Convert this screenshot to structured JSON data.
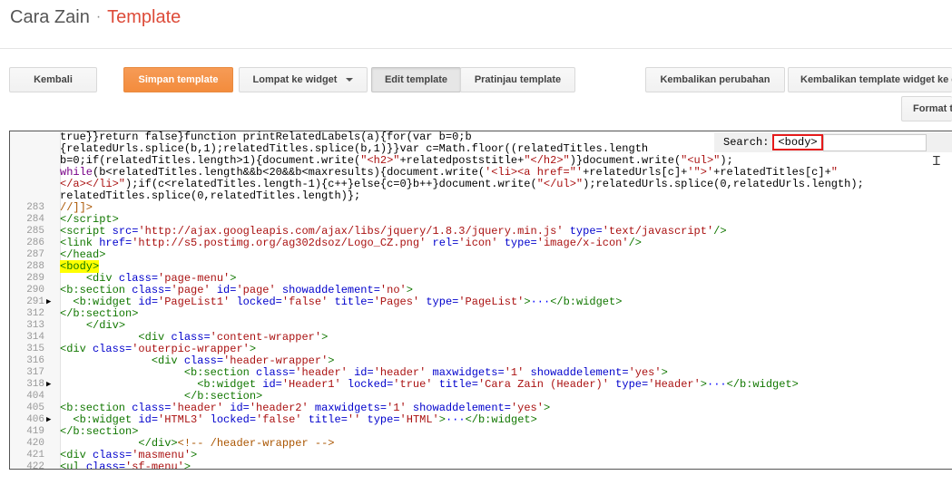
{
  "header": {
    "blog_name": "Cara Zain",
    "separator": "·",
    "page_name": "Template"
  },
  "toolbar": {
    "back": "Kembali",
    "save": "Simpan template",
    "jump": "Lompat ke widget",
    "edit": "Edit template",
    "preview": "Pratinjau template",
    "revert_changes": "Kembalikan perubahan",
    "revert_widgets": "Kembalikan template widget ke default",
    "format": "Format template"
  },
  "search": {
    "label": "Search:",
    "query": "<body>"
  },
  "editor": {
    "lines": [
      {
        "n": "",
        "m": "",
        "html": "true}}return false}function printRelatedLabels(a){for(var b=0;b<relatedUrls.length;b++){if"
      },
      {
        "n": "",
        "m": "",
        "html": "{relatedUrls.splice(b,1);relatedTitles.splice(b,1)}}var c=Math.floor((relatedTitles.length"
      },
      {
        "n": "",
        "m": "",
        "html": "b=0;if(relatedTitles.length>1){document.write(<span class=\"t-str\">\"&lt;h2&gt;\"</span>+relatedpoststitle+<span class=\"t-str\">\"&lt;/h2&gt;\"</span>)}document.write(<span class=\"t-str\">\"&lt;ul&gt;\"</span>);"
      },
      {
        "n": "",
        "m": "",
        "html": "<span class=\"t-kw\">while</span>(b&lt;relatedTitles.length&amp;&amp;b&lt;20&amp;&amp;b&lt;maxresults){document.write(<span class=\"t-str\">'&lt;li&gt;&lt;a href=\"'</span>+relatedUrls[c]+<span class=\"t-str\">'\"&gt;'</span>+relatedTitles[c]+<span class=\"t-str\">\"</span>"
      },
      {
        "n": "",
        "m": "",
        "html": "<span class=\"t-str\">&lt;/a&gt;&lt;/li&gt;\"</span>);if(c&lt;relatedTitles.length-1){c++}else{c=0}b++}document.write(<span class=\"t-str\">\"&lt;/ul&gt;\"</span>);relatedUrls.splice(0,relatedUrls.length);"
      },
      {
        "n": "",
        "m": "",
        "html": "relatedTitles.splice(0,relatedTitles.length)};"
      },
      {
        "n": "283",
        "m": "",
        "html": "<span class=\"t-cmt\">//]]&gt;</span>"
      },
      {
        "n": "284",
        "m": "",
        "html": "<span class=\"t-tag\">&lt;/script&gt;</span>"
      },
      {
        "n": "285",
        "m": "",
        "html": "<span class=\"t-tag\">&lt;script</span> <span class=\"t-attr\">src=</span><span class=\"t-str\">'http://ajax.googleapis.com/ajax/libs/jquery/1.8.3/jquery.min.js'</span> <span class=\"t-attr\">type=</span><span class=\"t-str\">'text/javascript'</span><span class=\"t-tag\">/&gt;</span>"
      },
      {
        "n": "286",
        "m": "",
        "html": "<span class=\"t-tag\">&lt;link</span> <span class=\"t-attr\">href=</span><span class=\"t-str\">'http://s5.postimg.org/ag302dsoz/Logo_CZ.png'</span> <span class=\"t-attr\">rel=</span><span class=\"t-str\">'icon'</span> <span class=\"t-attr\">type=</span><span class=\"t-str\">'image/x-icon'</span><span class=\"t-tag\">/&gt;</span>"
      },
      {
        "n": "287",
        "m": "",
        "html": "<span class=\"t-tag\">&lt;/head&gt;</span>"
      },
      {
        "n": "288",
        "m": "",
        "html": "<span class=\"t-tag hl\">&lt;body&gt;</span>"
      },
      {
        "n": "289",
        "m": "",
        "html": "    <span class=\"t-tag\">&lt;div</span> <span class=\"t-attr\">class=</span><span class=\"t-str\">'page-menu'</span><span class=\"t-tag\">&gt;</span>"
      },
      {
        "n": "290",
        "m": "",
        "html": "<span class=\"t-tag\">&lt;b:section</span> <span class=\"t-attr\">class=</span><span class=\"t-str\">'page'</span> <span class=\"t-attr\">id=</span><span class=\"t-str\">'page'</span> <span class=\"t-attr\">showaddelement=</span><span class=\"t-str\">'no'</span><span class=\"t-tag\">&gt;</span>"
      },
      {
        "n": "291",
        "m": "▶",
        "html": "  <span class=\"t-tag\">&lt;b:widget</span> <span class=\"t-attr\">id=</span><span class=\"t-str\">'PageList1'</span> <span class=\"t-attr\">locked=</span><span class=\"t-str\">'false'</span> <span class=\"t-attr\">title=</span><span class=\"t-str\">'Pages'</span> <span class=\"t-attr\">type=</span><span class=\"t-str\">'PageList'</span><span class=\"t-tag\">&gt;</span><span class=\"t-fold\">···</span><span class=\"t-tag\">&lt;/b:widget&gt;</span>"
      },
      {
        "n": "312",
        "m": "",
        "html": "<span class=\"t-tag\">&lt;/b:section&gt;</span>"
      },
      {
        "n": "313",
        "m": "",
        "html": "    <span class=\"t-tag\">&lt;/div&gt;</span>"
      },
      {
        "n": "314",
        "m": "",
        "html": "            <span class=\"t-tag\">&lt;div</span> <span class=\"t-attr\">class=</span><span class=\"t-str\">'content-wrapper'</span><span class=\"t-tag\">&gt;</span>"
      },
      {
        "n": "315",
        "m": "",
        "html": "<span class=\"t-tag\">&lt;div</span> <span class=\"t-attr\">class=</span><span class=\"t-str\">'outerpic-wrapper'</span><span class=\"t-tag\">&gt;</span>"
      },
      {
        "n": "316",
        "m": "",
        "html": "              <span class=\"t-tag\">&lt;div</span> <span class=\"t-attr\">class=</span><span class=\"t-str\">'header-wrapper'</span><span class=\"t-tag\">&gt;</span>"
      },
      {
        "n": "317",
        "m": "",
        "html": "                   <span class=\"t-tag\">&lt;b:section</span> <span class=\"t-attr\">class=</span><span class=\"t-str\">'header'</span> <span class=\"t-attr\">id=</span><span class=\"t-str\">'header'</span> <span class=\"t-attr\">maxwidgets=</span><span class=\"t-str\">'1'</span> <span class=\"t-attr\">showaddelement=</span><span class=\"t-str\">'yes'</span><span class=\"t-tag\">&gt;</span>"
      },
      {
        "n": "318",
        "m": "▶",
        "html": "                     <span class=\"t-tag\">&lt;b:widget</span> <span class=\"t-attr\">id=</span><span class=\"t-str\">'Header1'</span> <span class=\"t-attr\">locked=</span><span class=\"t-str\">'true'</span> <span class=\"t-attr\">title=</span><span class=\"t-str\">'Cara Zain (Header)'</span> <span class=\"t-attr\">type=</span><span class=\"t-str\">'Header'</span><span class=\"t-tag\">&gt;</span><span class=\"t-fold\">···</span><span class=\"t-tag\">&lt;/b:widget&gt;</span>"
      },
      {
        "n": "404",
        "m": "",
        "html": "                   <span class=\"t-tag\">&lt;/b:section&gt;</span>"
      },
      {
        "n": "405",
        "m": "",
        "html": "<span class=\"t-tag\">&lt;b:section</span> <span class=\"t-attr\">class=</span><span class=\"t-str\">'header'</span> <span class=\"t-attr\">id=</span><span class=\"t-str\">'header2'</span> <span class=\"t-attr\">maxwidgets=</span><span class=\"t-str\">'1'</span> <span class=\"t-attr\">showaddelement=</span><span class=\"t-str\">'yes'</span><span class=\"t-tag\">&gt;</span>"
      },
      {
        "n": "406",
        "m": "▶",
        "html": "  <span class=\"t-tag\">&lt;b:widget</span> <span class=\"t-attr\">id=</span><span class=\"t-str\">'HTML3'</span> <span class=\"t-attr\">locked=</span><span class=\"t-str\">'false'</span> <span class=\"t-attr\">title=</span><span class=\"t-str\">''</span> <span class=\"t-attr\">type=</span><span class=\"t-str\">'HTML'</span><span class=\"t-tag\">&gt;</span><span class=\"t-fold\">···</span><span class=\"t-tag\">&lt;/b:widget&gt;</span>"
      },
      {
        "n": "419",
        "m": "",
        "html": "<span class=\"t-tag\">&lt;/b:section&gt;</span>"
      },
      {
        "n": "420",
        "m": "",
        "html": "            <span class=\"t-tag\">&lt;/div&gt;</span><span class=\"t-cmt\">&lt;!-- /header-wrapper --&gt;</span>"
      },
      {
        "n": "421",
        "m": "",
        "html": "<span class=\"t-tag\">&lt;div</span> <span class=\"t-attr\">class=</span><span class=\"t-str\">'masmenu'</span><span class=\"t-tag\">&gt;</span>"
      },
      {
        "n": "422",
        "m": "",
        "html": "<span class=\"t-tag\">&lt;ul</span> <span class=\"t-attr\">class=</span><span class=\"t-str\">'sf-menu'</span><span class=\"t-tag\">&gt;</span>"
      }
    ]
  }
}
